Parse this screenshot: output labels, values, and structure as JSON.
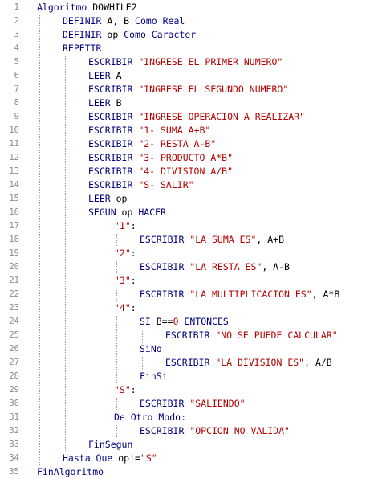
{
  "lines": [
    {
      "n": "1",
      "indent": 0,
      "parts": [
        [
          "kw",
          "Algoritmo"
        ],
        [
          "plain",
          " DOWHILE2"
        ]
      ]
    },
    {
      "n": "2",
      "indent": 1,
      "parts": [
        [
          "kw",
          "DEFINIR"
        ],
        [
          "plain",
          " A, B "
        ],
        [
          "kw",
          "Como Real"
        ]
      ]
    },
    {
      "n": "3",
      "indent": 1,
      "parts": [
        [
          "kw",
          "DEFINIR"
        ],
        [
          "plain",
          " op "
        ],
        [
          "kw",
          "Como Caracter"
        ]
      ]
    },
    {
      "n": "4",
      "indent": 1,
      "parts": [
        [
          "kw",
          "REPETIR"
        ]
      ]
    },
    {
      "n": "5",
      "indent": 2,
      "parts": [
        [
          "kw",
          "ESCRIBIR "
        ],
        [
          "str",
          "\"INGRESE EL PRIMER NUMERO\""
        ]
      ]
    },
    {
      "n": "6",
      "indent": 2,
      "parts": [
        [
          "kw",
          "LEER"
        ],
        [
          "plain",
          " A"
        ]
      ]
    },
    {
      "n": "7",
      "indent": 2,
      "parts": [
        [
          "kw",
          "ESCRIBIR "
        ],
        [
          "str",
          "\"INGRESE EL SEGUNDO NUMERO\""
        ]
      ]
    },
    {
      "n": "8",
      "indent": 2,
      "parts": [
        [
          "kw",
          "LEER"
        ],
        [
          "plain",
          " B"
        ]
      ]
    },
    {
      "n": "9",
      "indent": 2,
      "parts": [
        [
          "kw",
          "ESCRIBIR "
        ],
        [
          "str",
          "\"INGRESE OPERACION A REALIZAR\""
        ]
      ]
    },
    {
      "n": "10",
      "indent": 2,
      "parts": [
        [
          "kw",
          "ESCRIBIR "
        ],
        [
          "str",
          "\"1- SUMA A+B\""
        ]
      ]
    },
    {
      "n": "11",
      "indent": 2,
      "parts": [
        [
          "kw",
          "ESCRIBIR "
        ],
        [
          "str",
          "\"2- RESTA A-B\""
        ]
      ]
    },
    {
      "n": "12",
      "indent": 2,
      "parts": [
        [
          "kw",
          "ESCRIBIR "
        ],
        [
          "str",
          "\"3- PRODUCTO A*B\""
        ]
      ]
    },
    {
      "n": "13",
      "indent": 2,
      "parts": [
        [
          "kw",
          "ESCRIBIR "
        ],
        [
          "str",
          "\"4- DIVISION A/B\""
        ]
      ]
    },
    {
      "n": "14",
      "indent": 2,
      "parts": [
        [
          "kw",
          "ESCRIBIR "
        ],
        [
          "str",
          "\"S- SALIR\""
        ]
      ]
    },
    {
      "n": "15",
      "indent": 2,
      "parts": [
        [
          "kw",
          "LEER"
        ],
        [
          "plain",
          " op"
        ]
      ]
    },
    {
      "n": "16",
      "indent": 2,
      "parts": [
        [
          "kw",
          "SEGUN"
        ],
        [
          "plain",
          " op "
        ],
        [
          "kw",
          "HACER"
        ]
      ]
    },
    {
      "n": "17",
      "indent": 3,
      "parts": [
        [
          "str",
          "\"1\""
        ],
        [
          "plain",
          ":"
        ]
      ]
    },
    {
      "n": "18",
      "indent": 4,
      "parts": [
        [
          "kw",
          "ESCRIBIR "
        ],
        [
          "str",
          "\"LA SUMA ES\""
        ],
        [
          "plain",
          ", A+B"
        ]
      ]
    },
    {
      "n": "19",
      "indent": 3,
      "parts": [
        [
          "str",
          "\"2\""
        ],
        [
          "plain",
          ":"
        ]
      ]
    },
    {
      "n": "20",
      "indent": 4,
      "parts": [
        [
          "kw",
          "ESCRIBIR "
        ],
        [
          "str",
          "\"LA RESTA ES\""
        ],
        [
          "plain",
          ", A-B"
        ]
      ]
    },
    {
      "n": "21",
      "indent": 3,
      "parts": [
        [
          "str",
          "\"3\""
        ],
        [
          "plain",
          ":"
        ]
      ]
    },
    {
      "n": "22",
      "indent": 4,
      "parts": [
        [
          "kw",
          "ESCRIBIR "
        ],
        [
          "str",
          "\"LA MULTIPLICACION ES\""
        ],
        [
          "plain",
          ", A*B"
        ]
      ]
    },
    {
      "n": "23",
      "indent": 3,
      "parts": [
        [
          "str",
          "\"4\""
        ],
        [
          "plain",
          ":"
        ]
      ]
    },
    {
      "n": "24",
      "indent": 4,
      "parts": [
        [
          "kw",
          "SI"
        ],
        [
          "plain",
          " B=="
        ],
        [
          "num",
          "0"
        ],
        [
          "kw",
          " ENTONCES"
        ]
      ]
    },
    {
      "n": "25",
      "indent": 5,
      "parts": [
        [
          "kw",
          "ESCRIBIR "
        ],
        [
          "str",
          "\"NO SE PUEDE CALCULAR\""
        ]
      ]
    },
    {
      "n": "26",
      "indent": 4,
      "parts": [
        [
          "kw",
          "SiNo"
        ]
      ]
    },
    {
      "n": "27",
      "indent": 5,
      "parts": [
        [
          "kw",
          "ESCRIBIR "
        ],
        [
          "str",
          "\"LA DIVISION ES\""
        ],
        [
          "plain",
          ", A/B"
        ]
      ]
    },
    {
      "n": "28",
      "indent": 4,
      "parts": [
        [
          "kw",
          "FinSi"
        ]
      ]
    },
    {
      "n": "29",
      "indent": 3,
      "parts": [
        [
          "str",
          "\"S\""
        ],
        [
          "plain",
          ":"
        ]
      ]
    },
    {
      "n": "30",
      "indent": 4,
      "parts": [
        [
          "kw",
          "ESCRIBIR "
        ],
        [
          "str",
          "\"SALIENDO\""
        ]
      ]
    },
    {
      "n": "31",
      "indent": 3,
      "parts": [
        [
          "kw",
          "De Otro Modo:"
        ]
      ]
    },
    {
      "n": "32",
      "indent": 4,
      "parts": [
        [
          "kw",
          "ESCRIBIR "
        ],
        [
          "str",
          "\"OPCION NO VALIDA\""
        ]
      ]
    },
    {
      "n": "33",
      "indent": 2,
      "parts": [
        [
          "kw",
          "FinSegun"
        ]
      ]
    },
    {
      "n": "34",
      "indent": 1,
      "parts": [
        [
          "kw",
          "Hasta Que"
        ],
        [
          "plain",
          " op!="
        ],
        [
          "str",
          "\"S\""
        ]
      ]
    },
    {
      "n": "35",
      "indent": 0,
      "parts": [
        [
          "kw",
          "FinAlgoritmo"
        ]
      ]
    }
  ]
}
